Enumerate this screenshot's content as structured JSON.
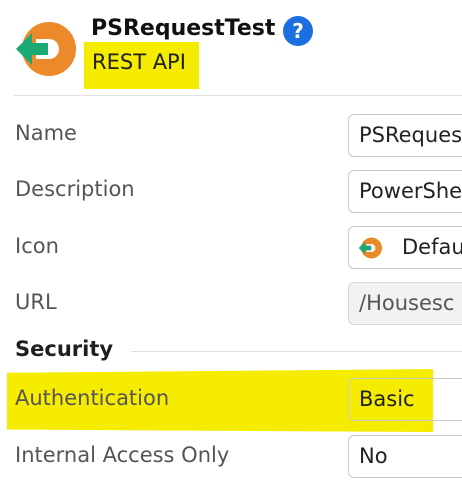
{
  "header": {
    "title": "PSRequestTest",
    "subtitle": "REST API",
    "help_symbol": "?",
    "logo_icon": "orange-circle-green-arrow-icon",
    "help_icon": "question-circle-icon",
    "highlight_color": "#f6ec00"
  },
  "form": {
    "name": {
      "label": "Name",
      "value": "PSReques"
    },
    "description": {
      "label": "Description",
      "value": "PowerShe"
    },
    "icon": {
      "label": "Icon",
      "value": "Defau"
    },
    "url": {
      "label": "URL",
      "value": "/Housesc"
    },
    "security": {
      "title": "Security",
      "authentication": {
        "label": "Authentication",
        "value": "Basic"
      },
      "internal_access_only": {
        "label": "Internal Access Only",
        "value": "No"
      }
    }
  },
  "colors": {
    "accent": "#1c6fe0",
    "logo_orange": "#ec8a2b",
    "logo_green": "#1aa873"
  }
}
